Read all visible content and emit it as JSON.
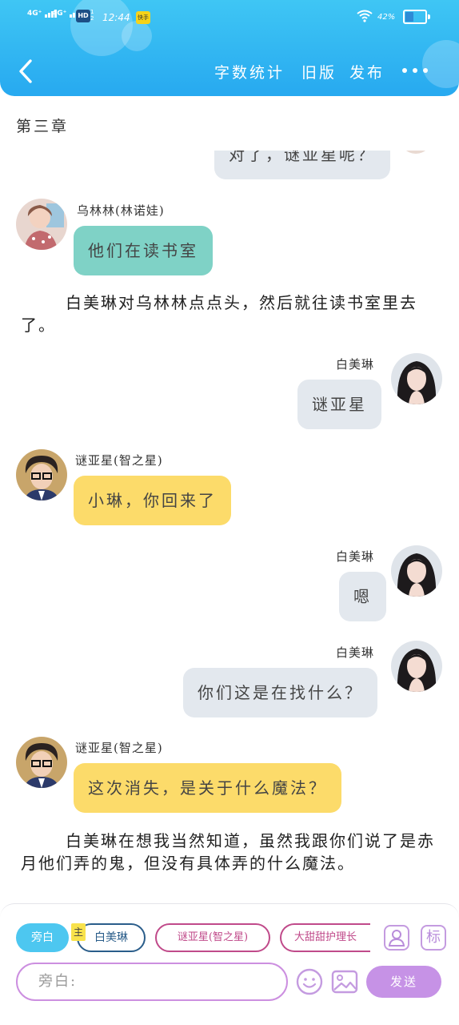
{
  "status_bar": {
    "network_1": "4G⁺",
    "network_2": "4G⁺",
    "hd": "HD",
    "hd_sub": "1\n2",
    "time": "12:44",
    "app_badge": "快手",
    "battery": "42%",
    "battery_level": 0.42
  },
  "header": {
    "word_count": "字数统计",
    "old_version": "旧版",
    "publish": "发布"
  },
  "chapter_title": "第三章",
  "messages": [
    {
      "speaker": "",
      "text": "对了，谜亚星呢？"
    },
    {
      "speaker": "乌林林(林诺娃)",
      "text": "他们在读书室"
    },
    {
      "narration": "白美琳对乌林林点点头，然后就往读书室里去了。"
    },
    {
      "speaker": "白美琳",
      "text": "谜亚星"
    },
    {
      "speaker": "谜亚星(智之星)",
      "text": "小琳，你回来了"
    },
    {
      "speaker": "白美琳",
      "text": "嗯"
    },
    {
      "speaker": "白美琳",
      "text": "你们这是在找什么？"
    },
    {
      "speaker": "谜亚星(智之星)",
      "text": "这次消失，是关于什么魔法？"
    },
    {
      "narration": "白美琳在想我当然知道，虽然我跟你们说了是赤月他们弄的鬼，但没有具体弄的什么魔法。"
    }
  ],
  "composer": {
    "roles": [
      "旁白",
      "白美琳",
      "谜亚星(智之星)",
      "大甜甜护理长"
    ],
    "main_tag": "主",
    "role_icon": "person-icon",
    "tag_icon": "标",
    "placeholder": "旁白:",
    "send": "发送"
  },
  "colors": {
    "header": "#27a9f0",
    "bubble_green": "#7fd2c6",
    "bubble_yellow": "#fcdb6a",
    "bubble_gray": "#e3e8ee",
    "send": "#c692e6"
  }
}
